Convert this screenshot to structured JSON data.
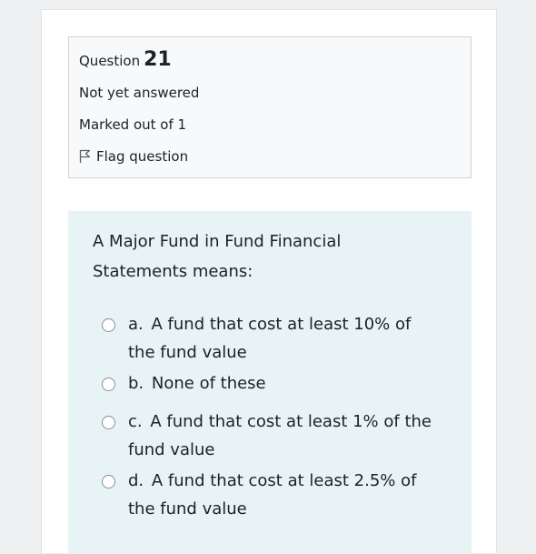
{
  "info": {
    "question_label": "Question",
    "question_number": "21",
    "state": "Not yet answered",
    "grade": "Marked out of 1",
    "flag_label": "Flag question"
  },
  "question": {
    "text": "A Major Fund in Fund Financial Statements means:",
    "options": [
      {
        "prefix": "a.",
        "text": "A fund that cost at least 10% of the fund value"
      },
      {
        "prefix": "b.",
        "text": "None of these"
      },
      {
        "prefix": "c.",
        "text": "A fund that cost at least 1% of the fund value"
      },
      {
        "prefix": "d.",
        "text": "A fund that cost at least 2.5% of the fund value"
      }
    ]
  },
  "colors": {
    "info_bg": "#f8f9fa",
    "content_bg": "#e7f3f5",
    "text": "#1d2125"
  }
}
